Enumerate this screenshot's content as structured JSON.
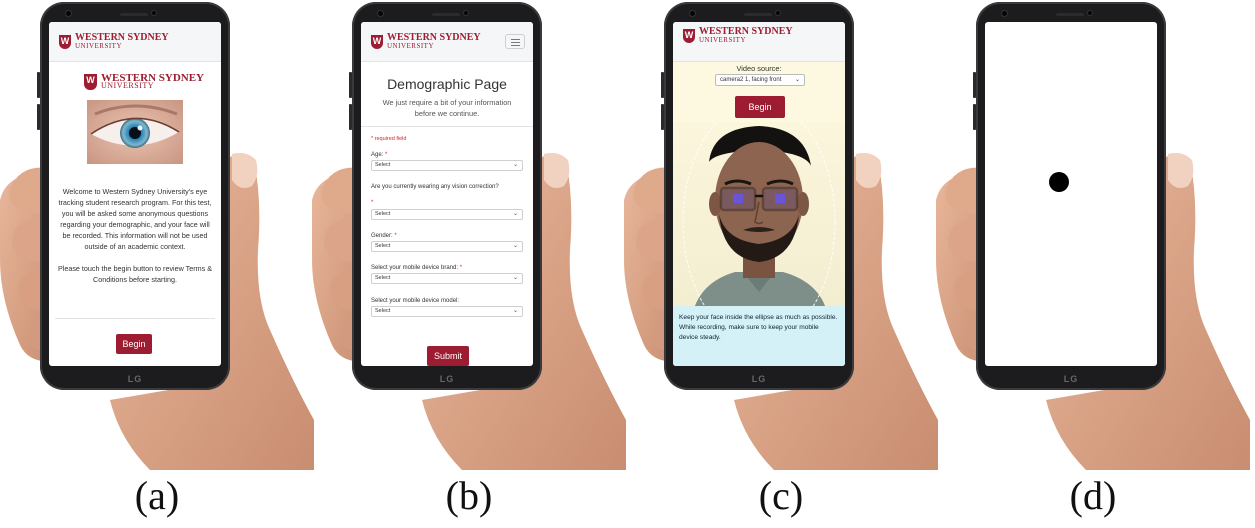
{
  "site": {
    "logo_mark": "W",
    "logo_main": "WESTERN SYDNEY",
    "logo_sub": "UNIVERSITY"
  },
  "phone_brand": "LG",
  "captions": [
    "(a)",
    "(b)",
    "(c)",
    "(d)"
  ],
  "screen_a": {
    "welcome_text": "Welcome to Western Sydney University's eye tracking student research program. For this test, you will be asked some anonymous questions regarding your demographic, and your face will be recorded. This information will not be used outside of an academic context.",
    "instruction_text": "Please touch the begin button to review Terms & Conditions before starting.",
    "begin_label": "Begin"
  },
  "screen_b": {
    "title": "Demographic Page",
    "subtitle": "We just require a bit of your information before we continue.",
    "required_note": "* required field",
    "fields": [
      {
        "label": "Age:",
        "required": true,
        "value": "Select"
      },
      {
        "label": "Are you currently wearing any vision correction?",
        "required": true,
        "value": "Select"
      },
      {
        "label": "Gender:",
        "required": true,
        "value": "Select"
      },
      {
        "label": "Select your mobile device brand:",
        "required": true,
        "value": "Select"
      },
      {
        "label": "Select your mobile device model:",
        "required": false,
        "value": "Select"
      }
    ],
    "submit_label": "Submit"
  },
  "screen_c": {
    "video_source_label": "Video source:",
    "video_source_value": "camera2 1, facing front",
    "begin_label": "Begin",
    "tip_text": "Keep your face inside the ellipse as much as possible. While recording, make sure to keep your mobile device steady."
  },
  "colors": {
    "brand": "#9d1c31",
    "tip_background": "#d3f1f6",
    "video_background": "#fdf8e0"
  }
}
